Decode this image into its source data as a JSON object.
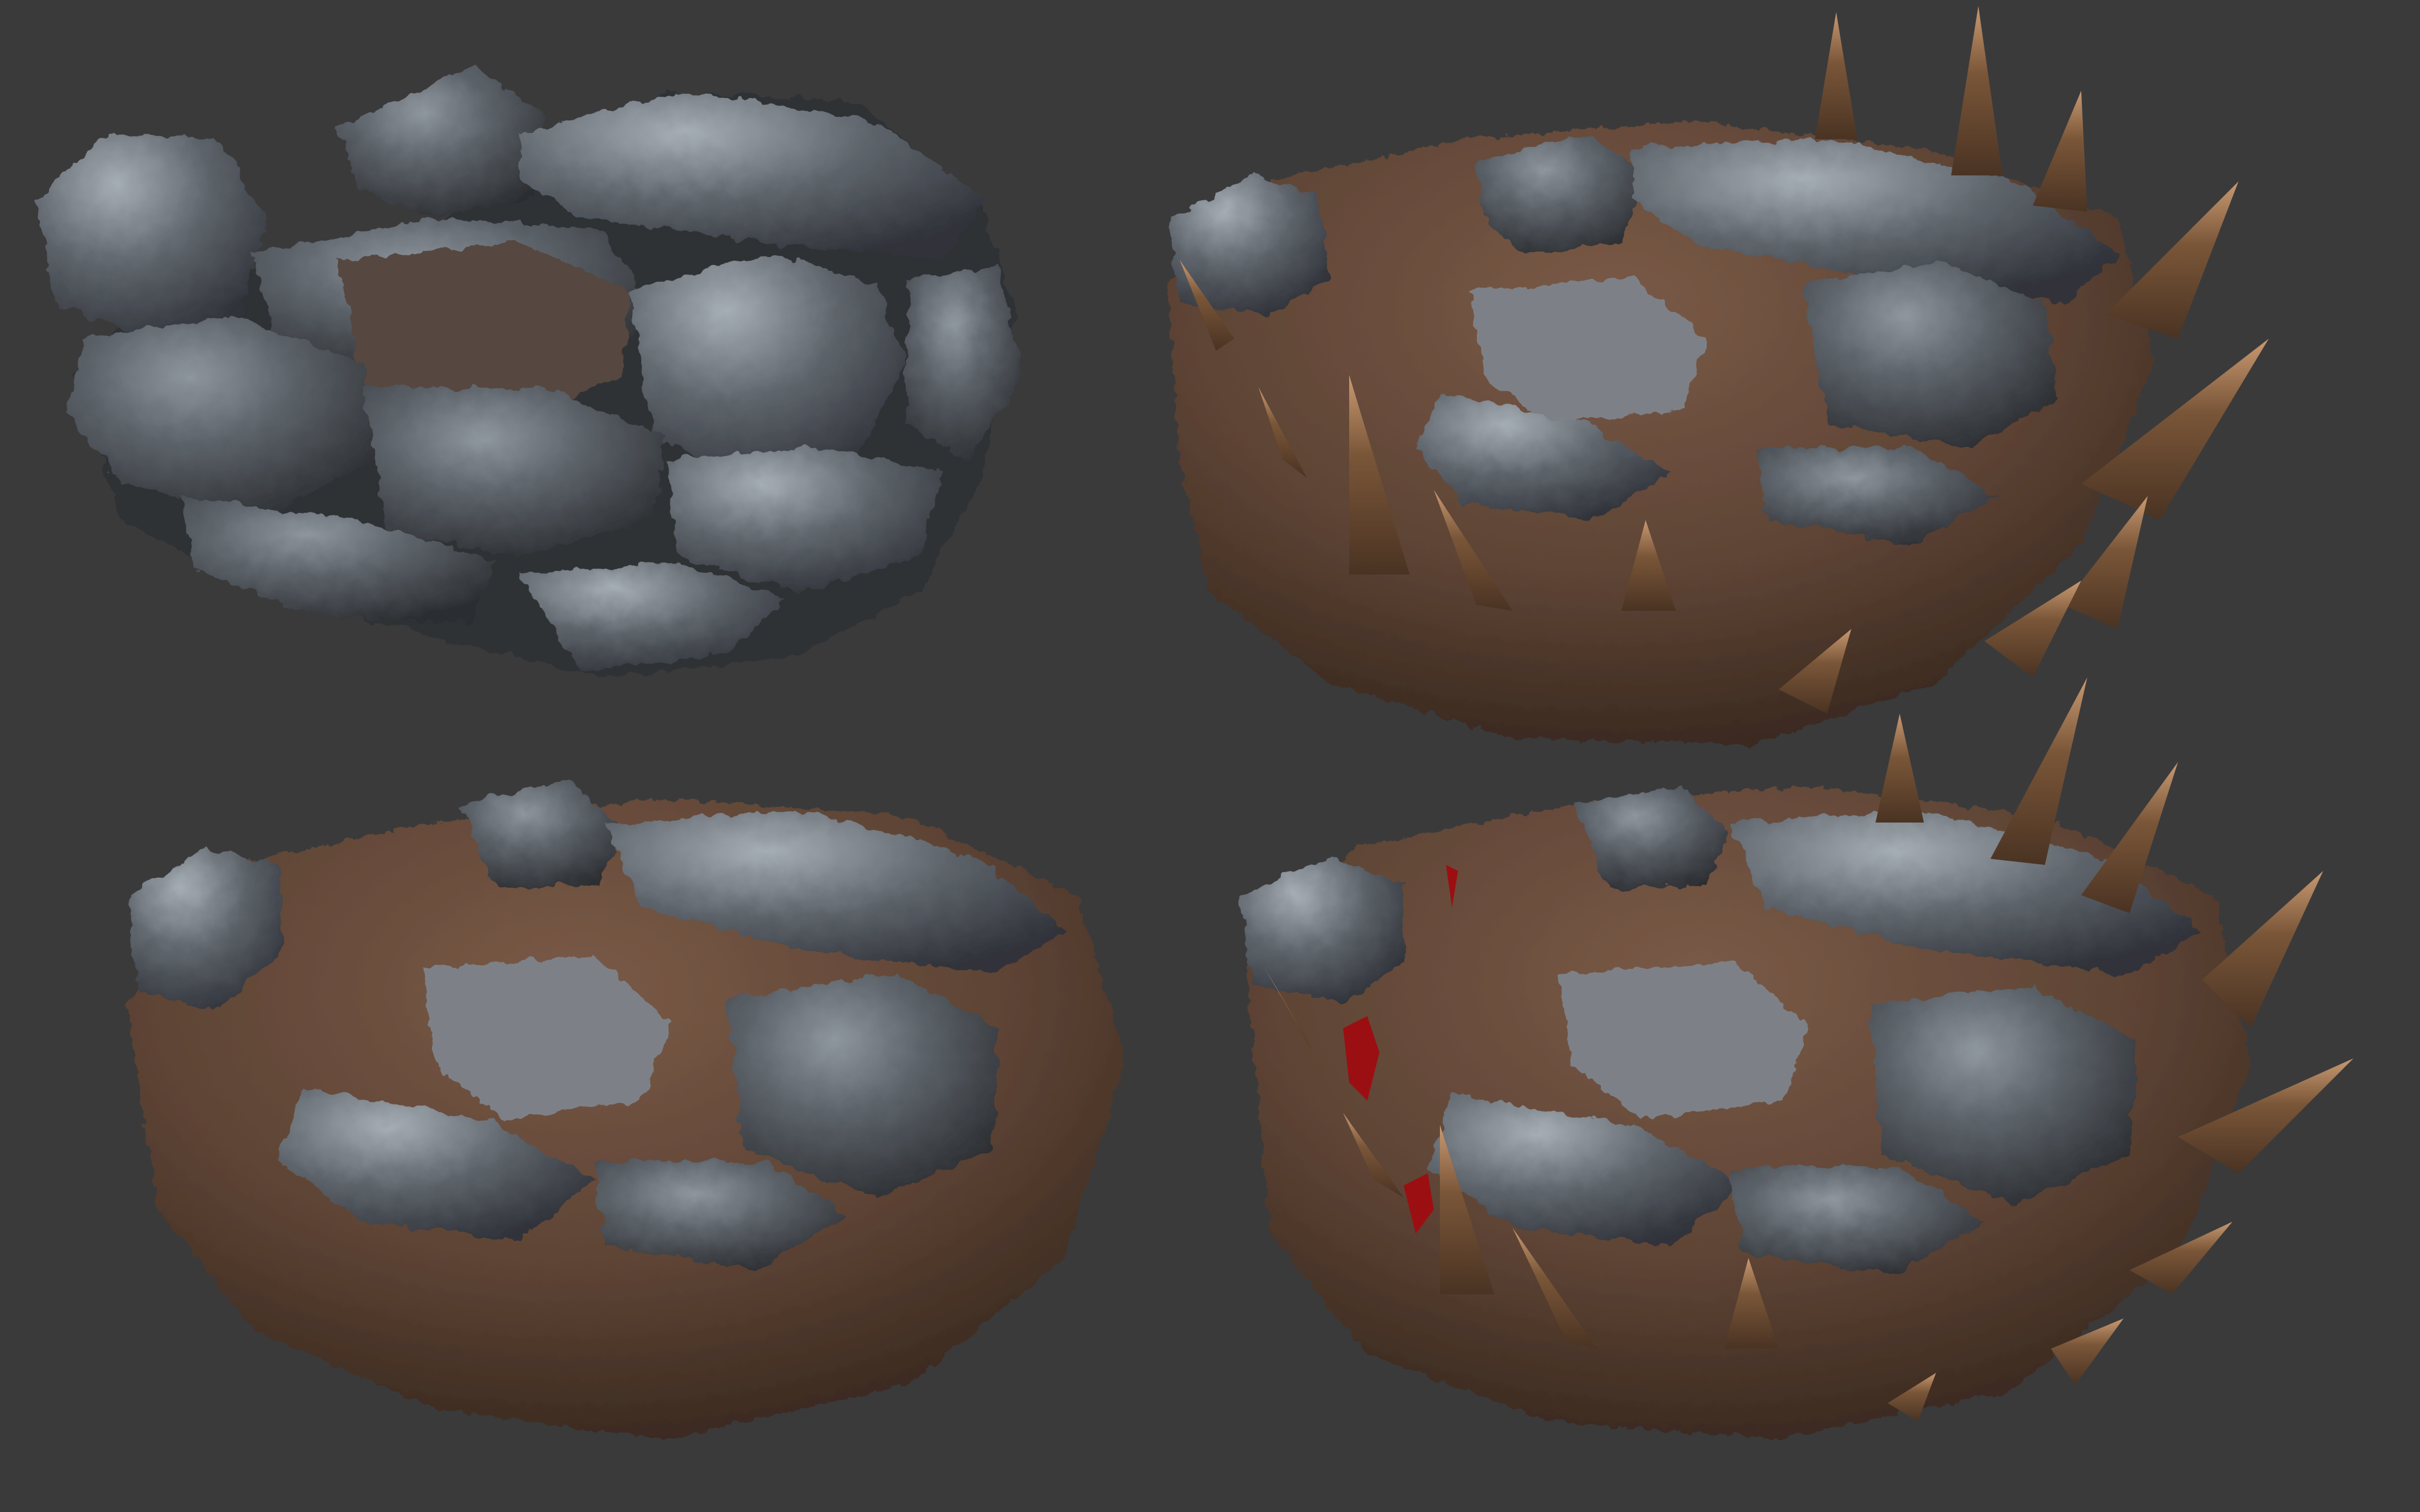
{
  "viewport": {
    "background_color": "#3a3a3b"
  },
  "palette": {
    "stone_dark": "#3c3f44",
    "stone_mid": "#5b6168",
    "stone_light": "#8e969e",
    "stone_highlight": "#c7d0d6",
    "mud_dark": "#3b2a20",
    "mud_mid": "#5d4334",
    "mud_light": "#7a5a47",
    "stake_base": "#5a3e2a",
    "stake_tip": "#c99a72",
    "blood": "#9b0f12"
  },
  "renders": [
    {
      "id": "rocks-only",
      "layers": [
        "stone"
      ]
    },
    {
      "id": "rocks-mud-stakes",
      "layers": [
        "stone",
        "mud",
        "stakes"
      ]
    },
    {
      "id": "rocks-mud",
      "layers": [
        "stone",
        "mud"
      ]
    },
    {
      "id": "rocks-mud-stakes-blood",
      "layers": [
        "stone",
        "mud",
        "stakes",
        "blood"
      ]
    }
  ]
}
